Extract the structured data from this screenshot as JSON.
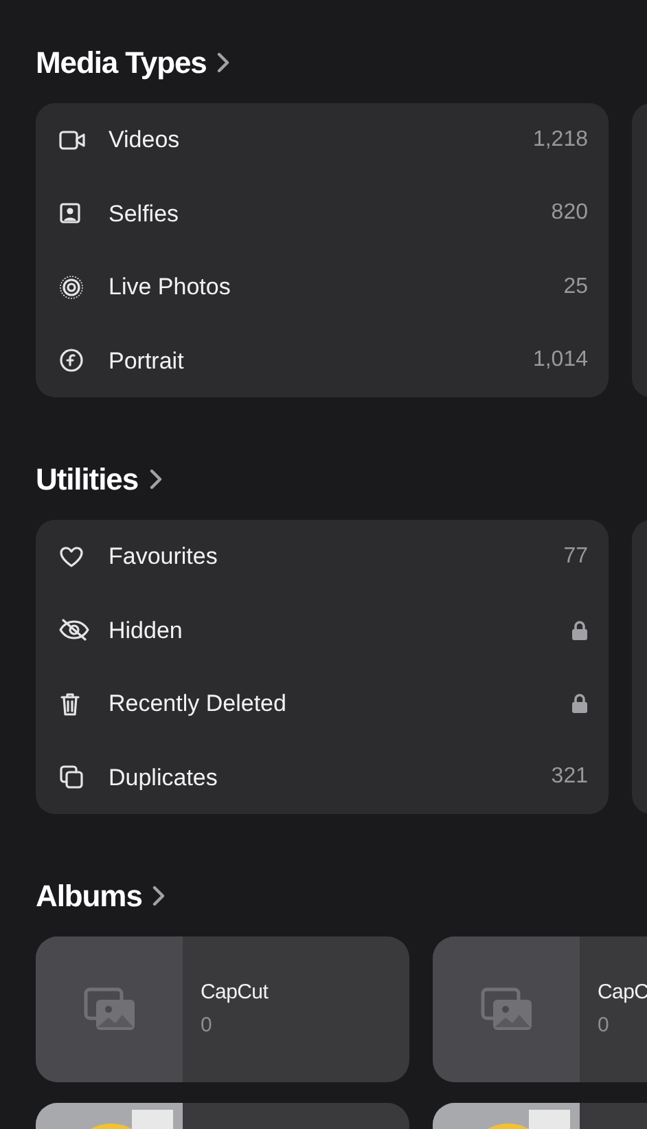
{
  "sections": [
    {
      "title": "Media Types",
      "items": [
        {
          "label": "Videos",
          "locked": false,
          "count": "1,218"
        },
        {
          "label": "Selfies",
          "locked": false,
          "count": "820"
        },
        {
          "label": "Live Photos",
          "locked": false,
          "count": "25"
        },
        {
          "label": "Portrait",
          "locked": false,
          "count": "1,014"
        }
      ]
    },
    {
      "title": "Utilities",
      "items": [
        {
          "label": "Favourites",
          "locked": false,
          "count": "77"
        },
        {
          "label": "Hidden",
          "locked": true
        },
        {
          "label": "Recently Deleted",
          "locked": true
        },
        {
          "label": "Duplicates",
          "locked": false,
          "count": "321"
        }
      ]
    }
  ],
  "albums": {
    "title": "Albums",
    "items": [
      {
        "kind": "empty",
        "title": "CapCut",
        "count": "0"
      },
      {
        "kind": "empty",
        "title": "CapC",
        "count": "0"
      },
      {
        "kind": "picture"
      },
      {
        "kind": "picture"
      }
    ]
  }
}
